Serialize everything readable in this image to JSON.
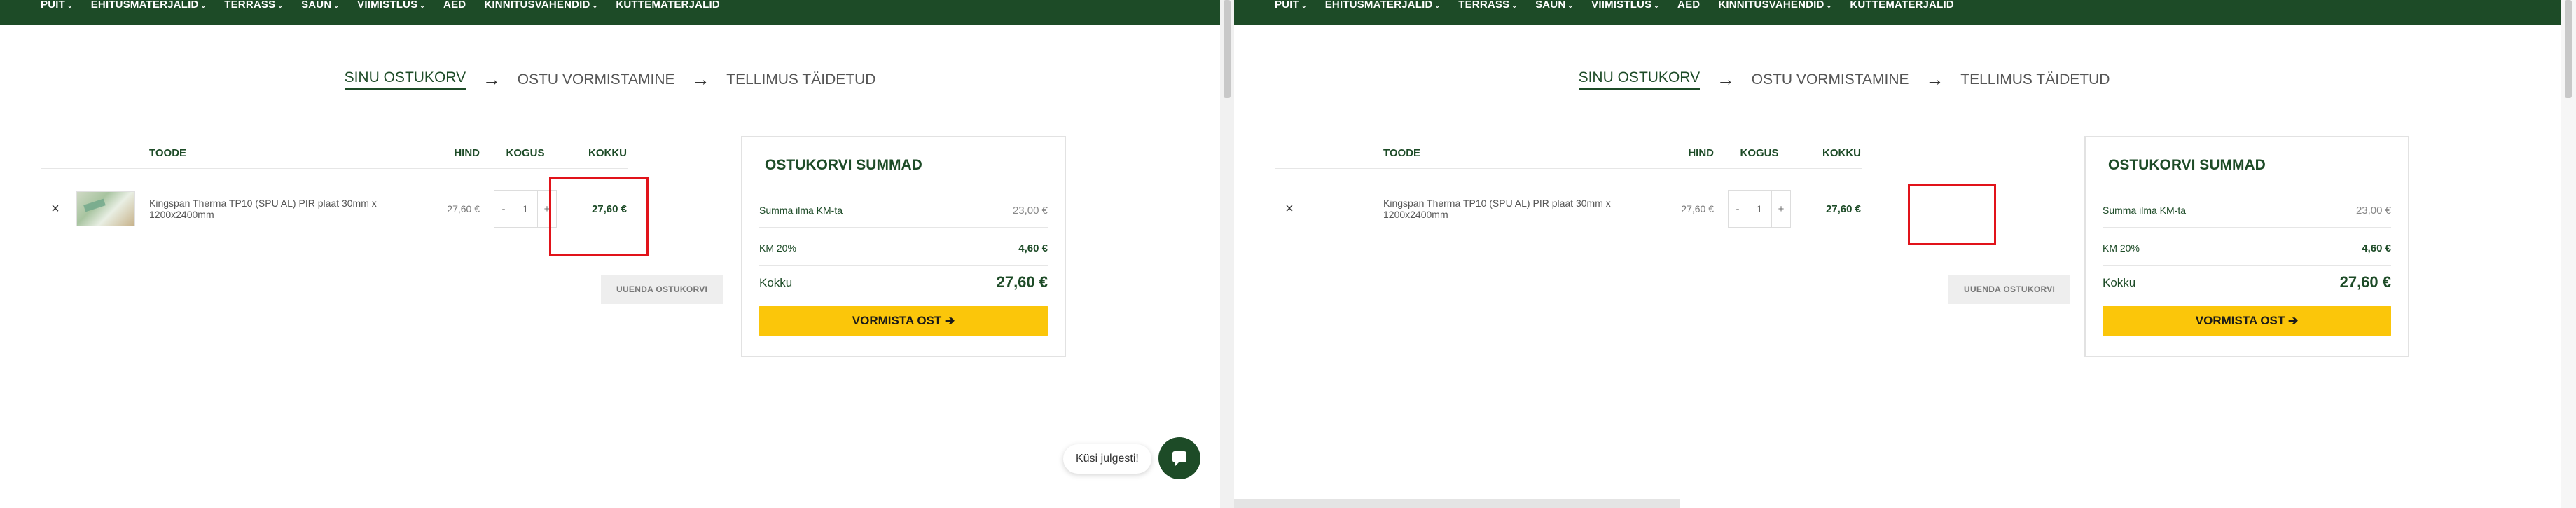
{
  "nav": {
    "items": [
      {
        "label": "PUIT",
        "has_dropdown": true
      },
      {
        "label": "EHITUSMATERJALID",
        "has_dropdown": true
      },
      {
        "label": "TERRASS",
        "has_dropdown": true
      },
      {
        "label": "SAUN",
        "has_dropdown": true
      },
      {
        "label": "VIIMISTLUS",
        "has_dropdown": true
      },
      {
        "label": "AED",
        "has_dropdown": false
      },
      {
        "label": "KINNITUSVAHENDID",
        "has_dropdown": true
      },
      {
        "label": "KÜTTEMATERJALID",
        "has_dropdown": false
      }
    ],
    "caret": "⌄"
  },
  "steps": {
    "step1": "SINU OSTUKORV",
    "step2": "OSTU VORMISTAMINE",
    "step3": "TELLIMUS TÄIDETUD",
    "arrow": "→"
  },
  "cart": {
    "headers": {
      "product": "TOODE",
      "price": "HIND",
      "quantity": "KOGUS",
      "subtotal": "KOKKU"
    },
    "item": {
      "remove": "×",
      "name": "Kingspan Therma TP10 (SPU AL) PIR plaat 30mm x 1200x2400mm",
      "price": "27,60 €",
      "quantity": "1",
      "minus": "-",
      "plus": "+",
      "subtotal": "27,60 €"
    },
    "update_button": "UUENDA OSTUKORVI"
  },
  "totals": {
    "title": "OSTUKORVI SUMMAD",
    "net_label": "Summa ilma KM-ta",
    "net_value": "23,00 €",
    "vat_label": "KM 20%",
    "vat_value": "4,60 €",
    "total_label": "Kokku",
    "total_value": "27,60 €",
    "checkout_button": "VORMISTA OST ➔"
  },
  "chat": {
    "bubble": "Küsi julgesti!",
    "icon": "chat-icon"
  },
  "colors": {
    "brand_green": "#1d4b27",
    "checkout_yellow": "#fbc60a",
    "highlight_red": "#e1131a"
  }
}
